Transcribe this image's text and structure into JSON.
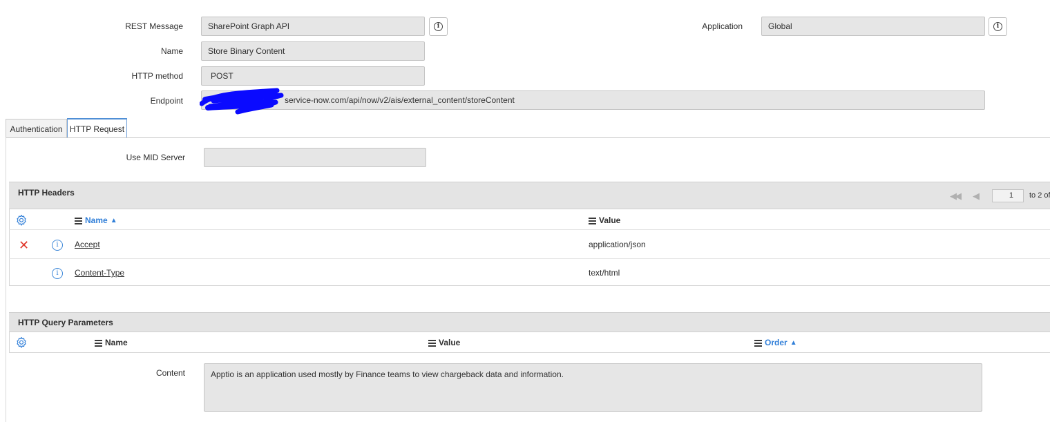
{
  "form": {
    "rest_message_label": "REST Message",
    "rest_message_value": "SharePoint Graph API",
    "application_label": "Application",
    "application_value": "Global",
    "name_label": "Name",
    "name_value": "Store Binary Content",
    "http_method_label": "HTTP method",
    "http_method_value": "POST",
    "endpoint_label": "Endpoint",
    "endpoint_value": "service-now.com/api/now/v2/ais/external_content/storeContent"
  },
  "tabs": [
    {
      "label": "Authentication",
      "active": false
    },
    {
      "label": "HTTP Request",
      "active": true
    }
  ],
  "http_request": {
    "mid_server_label": "Use MID Server",
    "mid_server_value": ""
  },
  "headers_list": {
    "title": "HTTP Headers",
    "pager": {
      "current": "1",
      "text": "to 2 of"
    },
    "columns": [
      {
        "label": "Name",
        "sorted": "asc"
      },
      {
        "label": "Value",
        "sorted": ""
      }
    ],
    "rows": [
      {
        "name": "Accept",
        "value": "application/json",
        "deletable": true
      },
      {
        "name": "Content-Type",
        "value": "text/html",
        "deletable": false
      }
    ]
  },
  "query_params_list": {
    "title": "HTTP Query Parameters",
    "columns": [
      {
        "label": "Name",
        "sorted": ""
      },
      {
        "label": "Value",
        "sorted": ""
      },
      {
        "label": "Order",
        "sorted": "asc"
      }
    ]
  },
  "content": {
    "label": "Content",
    "value": "Apptio is an application used mostly by Finance teams to view chargeback data and information."
  },
  "colors": {
    "accent": "#2f7ed8",
    "delete": "#e0382c",
    "redaction": "#0a0aff",
    "readonly_bg": "#e6e6e6",
    "section_bg": "#e4e4e4"
  }
}
